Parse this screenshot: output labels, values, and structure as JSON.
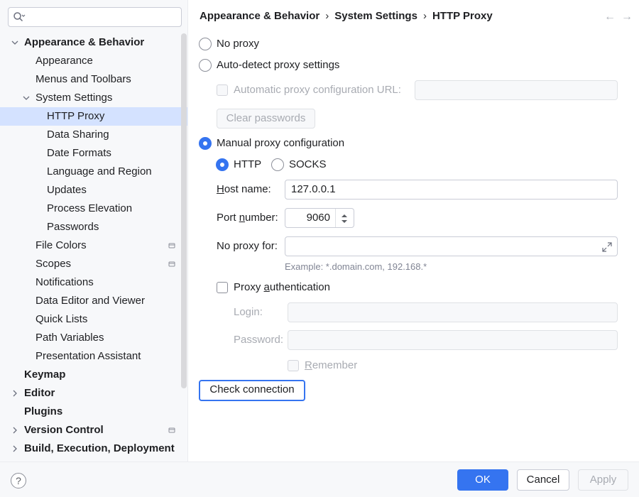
{
  "search": {
    "placeholder": "",
    "value": ""
  },
  "sidebar": {
    "items": [
      {
        "label": "Appearance & Behavior",
        "bold": true,
        "expanded": true,
        "level": 0
      },
      {
        "label": "Appearance",
        "level": 1
      },
      {
        "label": "Menus and Toolbars",
        "level": 1
      },
      {
        "label": "System Settings",
        "level": 1,
        "expanded": true
      },
      {
        "label": "HTTP Proxy",
        "level": 2,
        "selected": true
      },
      {
        "label": "Data Sharing",
        "level": 2
      },
      {
        "label": "Date Formats",
        "level": 2
      },
      {
        "label": "Language and Region",
        "level": 2
      },
      {
        "label": "Updates",
        "level": 2
      },
      {
        "label": "Process Elevation",
        "level": 2
      },
      {
        "label": "Passwords",
        "level": 2
      },
      {
        "label": "File Colors",
        "level": 1,
        "scope_icon": true
      },
      {
        "label": "Scopes",
        "level": 1,
        "scope_icon": true
      },
      {
        "label": "Notifications",
        "level": 1
      },
      {
        "label": "Data Editor and Viewer",
        "level": 1
      },
      {
        "label": "Quick Lists",
        "level": 1
      },
      {
        "label": "Path Variables",
        "level": 1
      },
      {
        "label": "Presentation Assistant",
        "level": 1
      },
      {
        "label": "Keymap",
        "bold": true,
        "level": 0
      },
      {
        "label": "Editor",
        "bold": true,
        "collapsed": true,
        "level": 0
      },
      {
        "label": "Plugins",
        "bold": true,
        "level": 0
      },
      {
        "label": "Version Control",
        "bold": true,
        "collapsed": true,
        "level": 0,
        "scope_icon": true
      },
      {
        "label": "Build, Execution, Deployment",
        "bold": true,
        "collapsed": true,
        "level": 0
      }
    ]
  },
  "breadcrumb": {
    "parts": [
      "Appearance & Behavior",
      "System Settings",
      "HTTP Proxy"
    ],
    "separator": "›"
  },
  "nav": {
    "back": "←",
    "forward": "→"
  },
  "proxy": {
    "no_proxy_label": "No proxy",
    "auto_detect_label": "Auto-detect proxy settings",
    "auto_config_url_label": "Automatic proxy configuration URL:",
    "auto_config_url_value": "",
    "clear_passwords_label": "Clear passwords",
    "manual_label": "Manual proxy configuration",
    "selected_mode": "manual",
    "http_label": "HTTP",
    "socks_label": "SOCKS",
    "selected_protocol": "HTTP",
    "host_label_pre": "H",
    "host_label_rest": "ost name:",
    "host_value": "127.0.0.1",
    "port_label_pre": "Port ",
    "port_label_u": "n",
    "port_label_rest": "umber:",
    "port_value": "9060",
    "no_proxy_for_label": "No proxy for:",
    "no_proxy_for_value": "",
    "example_hint": "Example: *.domain.com, 192.168.*",
    "auth_label_pre": "Proxy ",
    "auth_label_u": "a",
    "auth_label_rest": "uthentication",
    "auth_checked": false,
    "login_label": "Login:",
    "login_value": "",
    "password_label": "Password:",
    "password_value": "",
    "remember_u": "R",
    "remember_rest": "emember",
    "check_connection_label": "Check connection"
  },
  "footer": {
    "help_label": "?",
    "ok_label": "OK",
    "cancel_label": "Cancel",
    "apply_label": "Apply"
  },
  "colors": {
    "accent": "#3574f0",
    "selection": "#d4e2ff",
    "sidebar_bg": "#f7f8fa"
  }
}
